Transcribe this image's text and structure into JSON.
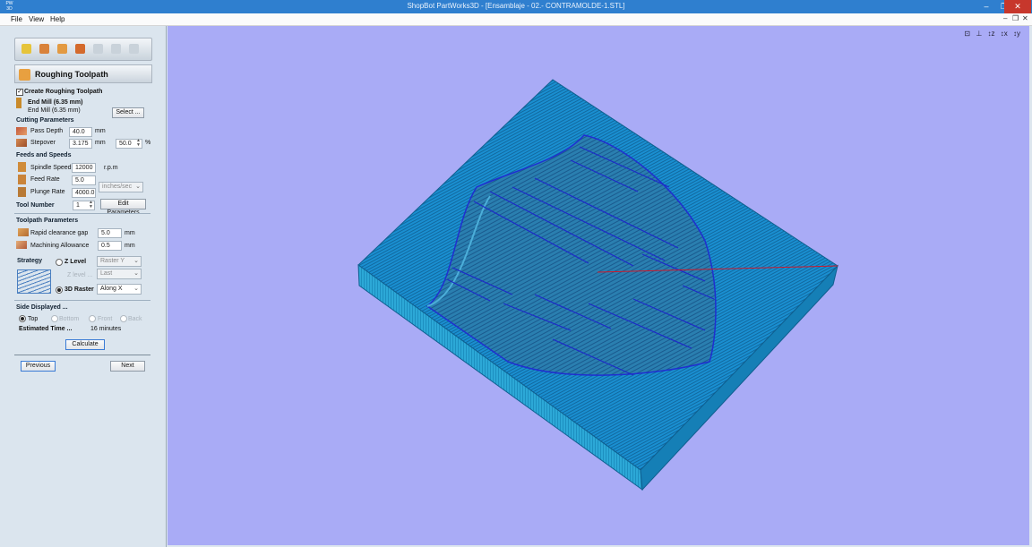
{
  "window": {
    "app_icon": "PW 3D",
    "title": "ShopBot PartWorks3D - [Ensamblaje - 02.- CONTRAMOLDE-1.STL]",
    "minimize": "–",
    "restore": "❐",
    "close": "✕"
  },
  "menu": {
    "items": [
      "File",
      "View",
      "Help"
    ],
    "mdi": {
      "min": "–",
      "restore": "❐",
      "close": "✕"
    }
  },
  "steps": [
    "1",
    "2",
    "3",
    "4",
    "5",
    "6",
    "7"
  ],
  "panel": {
    "header": "Roughing Toolpath",
    "header_step": "3",
    "create_label": "Create Roughing Toolpath",
    "tool_name": "End Mill (6.35 mm)",
    "tool_sub": "End Mill (6.35 mm)",
    "select_button": "Select ...",
    "cutting_title": "Cutting Parameters",
    "pass_depth_label": "Pass Depth",
    "pass_depth_value": "40.0",
    "pass_depth_unit": "mm",
    "stepover_label": "Stepover",
    "stepover_value": "3.175",
    "stepover_unit": "mm",
    "stepover_pct": "50.0",
    "pct_symbol": "%",
    "feeds_title": "Feeds and Speeds",
    "spindle_label": "Spindle Speed",
    "spindle_value": "12000",
    "spindle_unit": "r.p.m",
    "feed_label": "Feed Rate",
    "feed_value": "5.0",
    "plunge_label": "Plunge Rate",
    "plunge_value": "4000.0",
    "rate_units": "inches/sec",
    "tool_number_label": "Tool Number",
    "tool_number_value": "1",
    "edit_params_button": "Edit Parameters",
    "toolpath_title": "Toolpath Parameters",
    "rapid_label": "Rapid clearance gap",
    "rapid_value": "5.0",
    "rapid_unit": "mm",
    "allowance_label": "Machining Allowance",
    "allowance_value": "0.5",
    "allowance_unit": "mm",
    "strategy_label": "Strategy",
    "zlevel_label": "Z Level",
    "zlevel_option": "Raster Y",
    "finish_label": "Z level ...",
    "finish_option": "Last",
    "raster_label": "3D Raster",
    "raster_option": "Along X",
    "side_title": "Side Displayed ...",
    "sides": [
      "Top",
      "Bottom",
      "Front",
      "Back"
    ],
    "est_label": "Estimated Time ...",
    "est_value": "16 minutes",
    "calculate_button": "Calculate",
    "previous_button": "Previous",
    "next_button": "Next"
  },
  "view_toolbar": [
    "⊡",
    "⊥",
    "↕z",
    "↕x",
    "↕y"
  ],
  "colors": {
    "title_bar": "#2f7fcf",
    "viewport_bg": "#a9abf6",
    "block_top": "#1b8fd0",
    "block_side_front": "#2aa8d6",
    "block_side_right": "#137eb4",
    "toolpath": "#1d2ac8",
    "toolpath_link": "#d0182a"
  }
}
